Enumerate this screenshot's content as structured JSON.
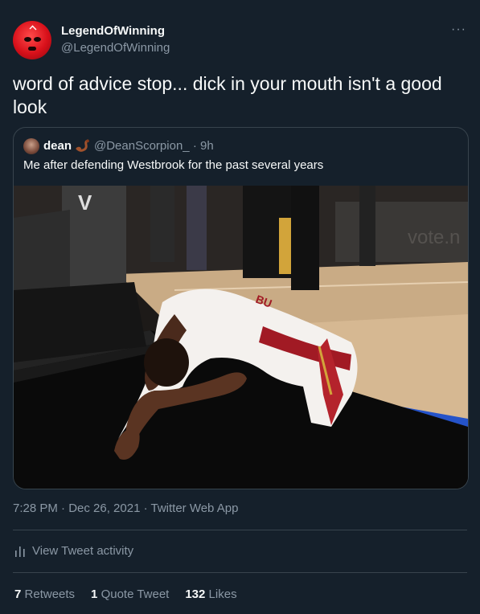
{
  "author": {
    "display_name": "LegendOfWinning",
    "handle": "@LegendOfWinning",
    "avatar_icon": "red-ski-mask-avatar"
  },
  "more_label": "···",
  "tweet_text": "word of advice stop... dick in your mouth isn't a good look",
  "quoted": {
    "display_name": "dean",
    "name_emoji": "scorpion-emoji",
    "handle": "@DeanScorpion_",
    "time": "· 9h",
    "text": "Me after defending Westbrook for the past several years",
    "image_overlay_text": "vote.n"
  },
  "meta": "7:28 PM · Dec 26, 2021 · Twitter Web App",
  "activity_label": "View Tweet activity",
  "stats": {
    "retweets_count": "7",
    "retweets_label": "Retweets",
    "quotes_count": "1",
    "quotes_label": "Quote Tweet",
    "likes_count": "132",
    "likes_label": "Likes"
  },
  "colors": {
    "background": "#15202b",
    "secondary_text": "#8b98a5",
    "border": "#38444d"
  }
}
